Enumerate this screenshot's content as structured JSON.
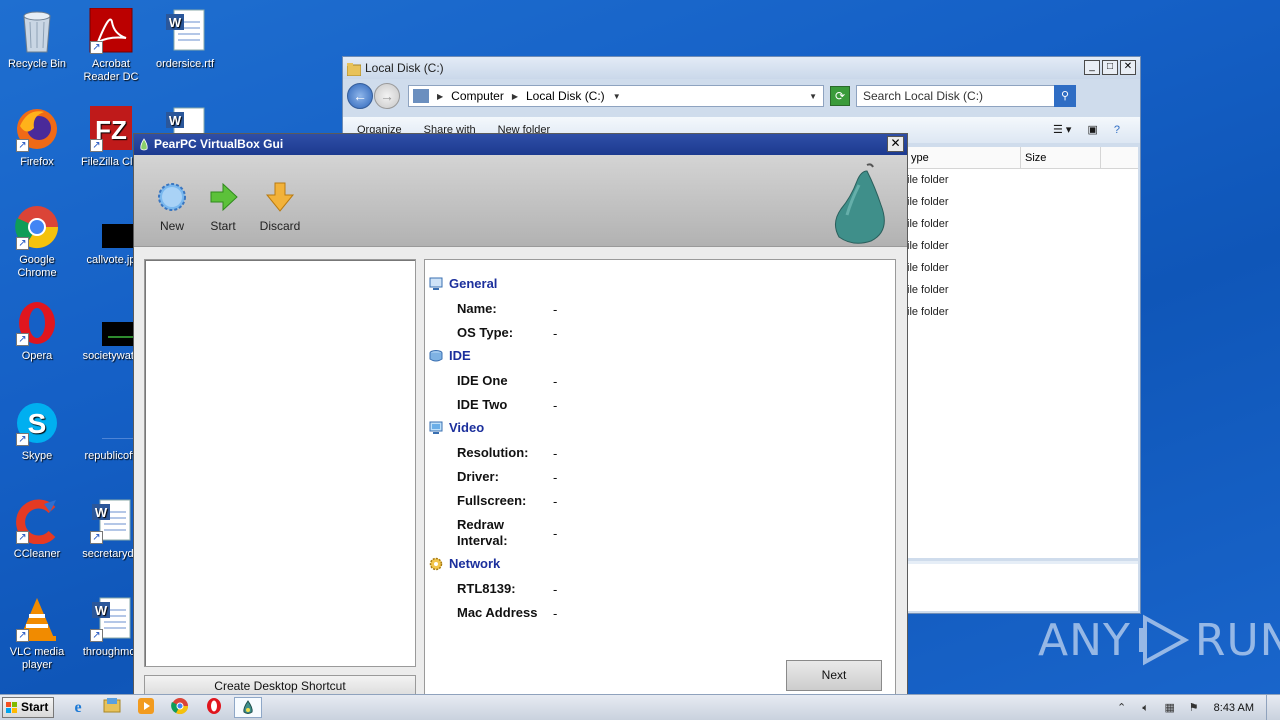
{
  "desktop": {
    "icons": [
      {
        "label": "Recycle Bin",
        "icon": "recycle-bin-icon"
      },
      {
        "label": "Acrobat Reader DC",
        "icon": "acrobat-icon"
      },
      {
        "label": "ordersice.rtf",
        "icon": "word-document-icon"
      },
      {
        "label": "Firefox",
        "icon": "firefox-icon"
      },
      {
        "label": "FileZilla Clie",
        "icon": "filezilla-icon"
      },
      {
        "label": "",
        "icon": "word-document-icon"
      },
      {
        "label": "Google Chrome",
        "icon": "chrome-icon"
      },
      {
        "label": "callvote.jp",
        "icon": "image-file-icon"
      },
      {
        "label": "Opera",
        "icon": "opera-icon"
      },
      {
        "label": "societywatc",
        "icon": "image-file-icon"
      },
      {
        "label": "Skype",
        "icon": "skype-icon"
      },
      {
        "label": "republicoffi",
        "icon": "blank-file-icon"
      },
      {
        "label": "CCleaner",
        "icon": "ccleaner-icon"
      },
      {
        "label": "secretaryde",
        "icon": "word-document-icon"
      },
      {
        "label": "VLC media player",
        "icon": "vlc-icon"
      },
      {
        "label": "throughmor",
        "icon": "word-document-icon"
      }
    ]
  },
  "explorer": {
    "title": "Local Disk (C:)",
    "breadcrumb": [
      "Computer",
      "Local Disk (C:)"
    ],
    "search_placeholder": "Search Local Disk (C:)",
    "commands": [
      "Organize",
      "Share with",
      "New folder"
    ],
    "columns": [
      "ype",
      "Size"
    ],
    "rows": [
      "ile folder",
      "ile folder",
      "ile folder",
      "ile folder",
      "ile folder",
      "ile folder",
      "ile folder"
    ],
    "window_buttons": {
      "minimize": "_",
      "maximize": "□",
      "close": "✕"
    }
  },
  "pearpc": {
    "title": "PearPC VirtualBox Gui",
    "toolbar": {
      "new": "New",
      "start": "Start",
      "discard": "Discard"
    },
    "sections": {
      "general": {
        "title": "General",
        "name_label": "Name:",
        "name_value": "-",
        "os_label": "OS Type:",
        "os_value": "-"
      },
      "ide": {
        "title": "IDE",
        "one_label": "IDE One",
        "one_value": "-",
        "two_label": "IDE Two",
        "two_value": "-"
      },
      "video": {
        "title": "Video",
        "res_label": "Resolution:",
        "res_value": "-",
        "driver_label": "Driver:",
        "driver_value": "-",
        "fs_label": "Fullscreen:",
        "fs_value": "-",
        "redraw_label_1": "Redraw",
        "redraw_label_2": "Interval:",
        "redraw_value": "-"
      },
      "network": {
        "title": "Network",
        "rtl_label": "RTL8139:",
        "rtl_value": "-",
        "mac_label": "Mac Address",
        "mac_value": "-"
      }
    },
    "create_shortcut": "Create Desktop Shortcut",
    "next": "Next",
    "close": "✕"
  },
  "watermark": {
    "left": "ANY",
    "right": "RUN"
  },
  "taskbar": {
    "start": "Start",
    "apps": [
      "ie-icon",
      "explorer-icon",
      "media-player-icon",
      "chrome-icon",
      "opera-icon",
      "pearpc-icon"
    ],
    "clock": "8:43 AM"
  },
  "colors": {
    "title_blue": "#1b2f9c",
    "pear_green": "#3f8f8a",
    "desktop_blue": "#1560c6"
  }
}
